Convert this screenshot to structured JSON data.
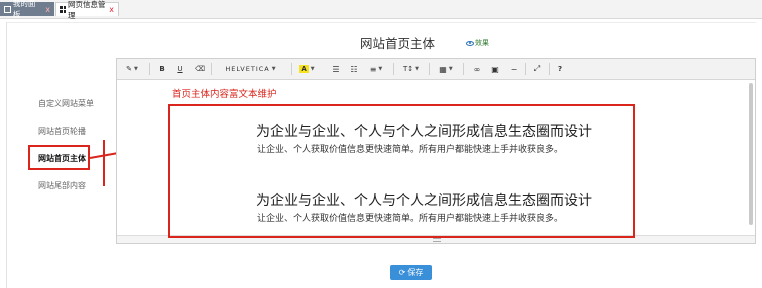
{
  "tabs": [
    {
      "label": "我的面板",
      "close": "x"
    },
    {
      "label": "网页信息管理",
      "close": "x"
    }
  ],
  "page_title": "网站首页主体",
  "preview_label": "效果",
  "menu": {
    "items": [
      "自定义网站菜单",
      "网站首页轮播",
      "网站首页主体",
      "网站尾部内容"
    ],
    "active_index": 2
  },
  "toolbar": {
    "magic_icon": "magic-wand-icon",
    "bold": "B",
    "underline": "U",
    "eraser_icon": "eraser-icon",
    "font_name": "HELVETICA",
    "color": "A",
    "unordered_list_icon": "ul-icon",
    "ordered_list_icon": "ol-icon",
    "align_icon": "align-icon",
    "text_size": "T↕",
    "table_icon": "table-icon",
    "link_icon": "link-icon",
    "image_icon": "image-icon",
    "hr_icon": "hr-icon",
    "fullscreen_icon": "fullscreen-icon",
    "help": "?"
  },
  "annotation": "首页主体内容富文本维护",
  "content": {
    "blocks": [
      {
        "heading": "为企业与企业、个人与个人之间形成信息生态圈而设计",
        "sub": "让企业、个人获取价值信息更快速简单。所有用户都能快速上手并收获良多。"
      },
      {
        "heading": "为企业与企业、个人与个人之间形成信息生态圈而设计",
        "sub": "让企业、个人获取价值信息更快速简单。所有用户都能快速上手并收获良多。"
      }
    ]
  },
  "save_label": "保存",
  "colors": {
    "accent_red": "#d9251c",
    "save_blue": "#3a8fd9",
    "highlight_yellow": "#f6e21e"
  }
}
